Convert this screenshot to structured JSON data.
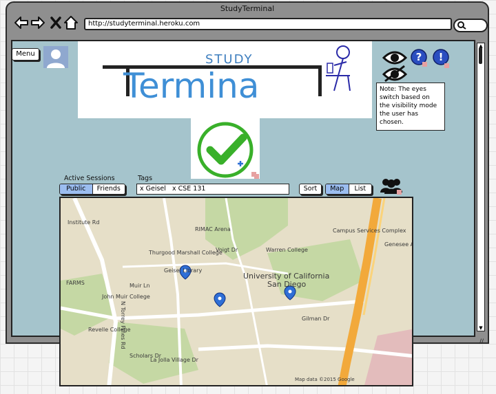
{
  "window": {
    "title": "StudyTerminal"
  },
  "browser": {
    "url": "http://studyterminal.heroku.com",
    "nav_icons": [
      "back-arrow-icon",
      "forward-arrow-icon",
      "close-icon",
      "home-icon"
    ],
    "search_icon": "search-icon"
  },
  "header": {
    "menu_label": "Menu",
    "logo_top": "STUDY",
    "logo_main": "Termina"
  },
  "icons": [
    "eye-icon",
    "help-icon",
    "alert-icon",
    "checkmark-icon",
    "group-icon"
  ],
  "note": {
    "text": "Note: The eyes switch based on the visibility mode the user has chosen."
  },
  "sessions": {
    "label": "Active Sessions",
    "options": [
      "Public",
      "Friends"
    ],
    "selected": "Public"
  },
  "tags": {
    "label": "Tags",
    "value": "x Geisel   x CSE 131"
  },
  "controls": {
    "sort_label": "Sort",
    "view_options": [
      "Map",
      "List"
    ],
    "view_selected": "Map"
  },
  "map": {
    "labels": {
      "campus_services": "Campus Services Complex",
      "university": "University of California",
      "san_diego": "San Diego",
      "rimac": "RIMAC Arena",
      "marshall": "Thurgood Marshall College",
      "warren": "Warren College",
      "geisel": "Geisel Library",
      "muir": "John Muir College",
      "revelle": "Revelle College",
      "institute": "Institute Rd",
      "gilman": "Gilman Dr",
      "lajolla": "La Jolla Village Dr",
      "genesee": "Genesee Ave",
      "north_torrey": "N Torrey Pines Rd",
      "farms": "FARMS",
      "muir_ln": "Muir Ln",
      "scholars": "Scholars Dr",
      "voigt": "Voigt Dr",
      "attribution": "Map data ©2015 Google"
    },
    "colors": {
      "land": "#e6dfc8",
      "park": "#c5d8a4",
      "freeway": "#f2a93b",
      "road": "#ffffff",
      "pin": "#2f6fd6"
    }
  }
}
